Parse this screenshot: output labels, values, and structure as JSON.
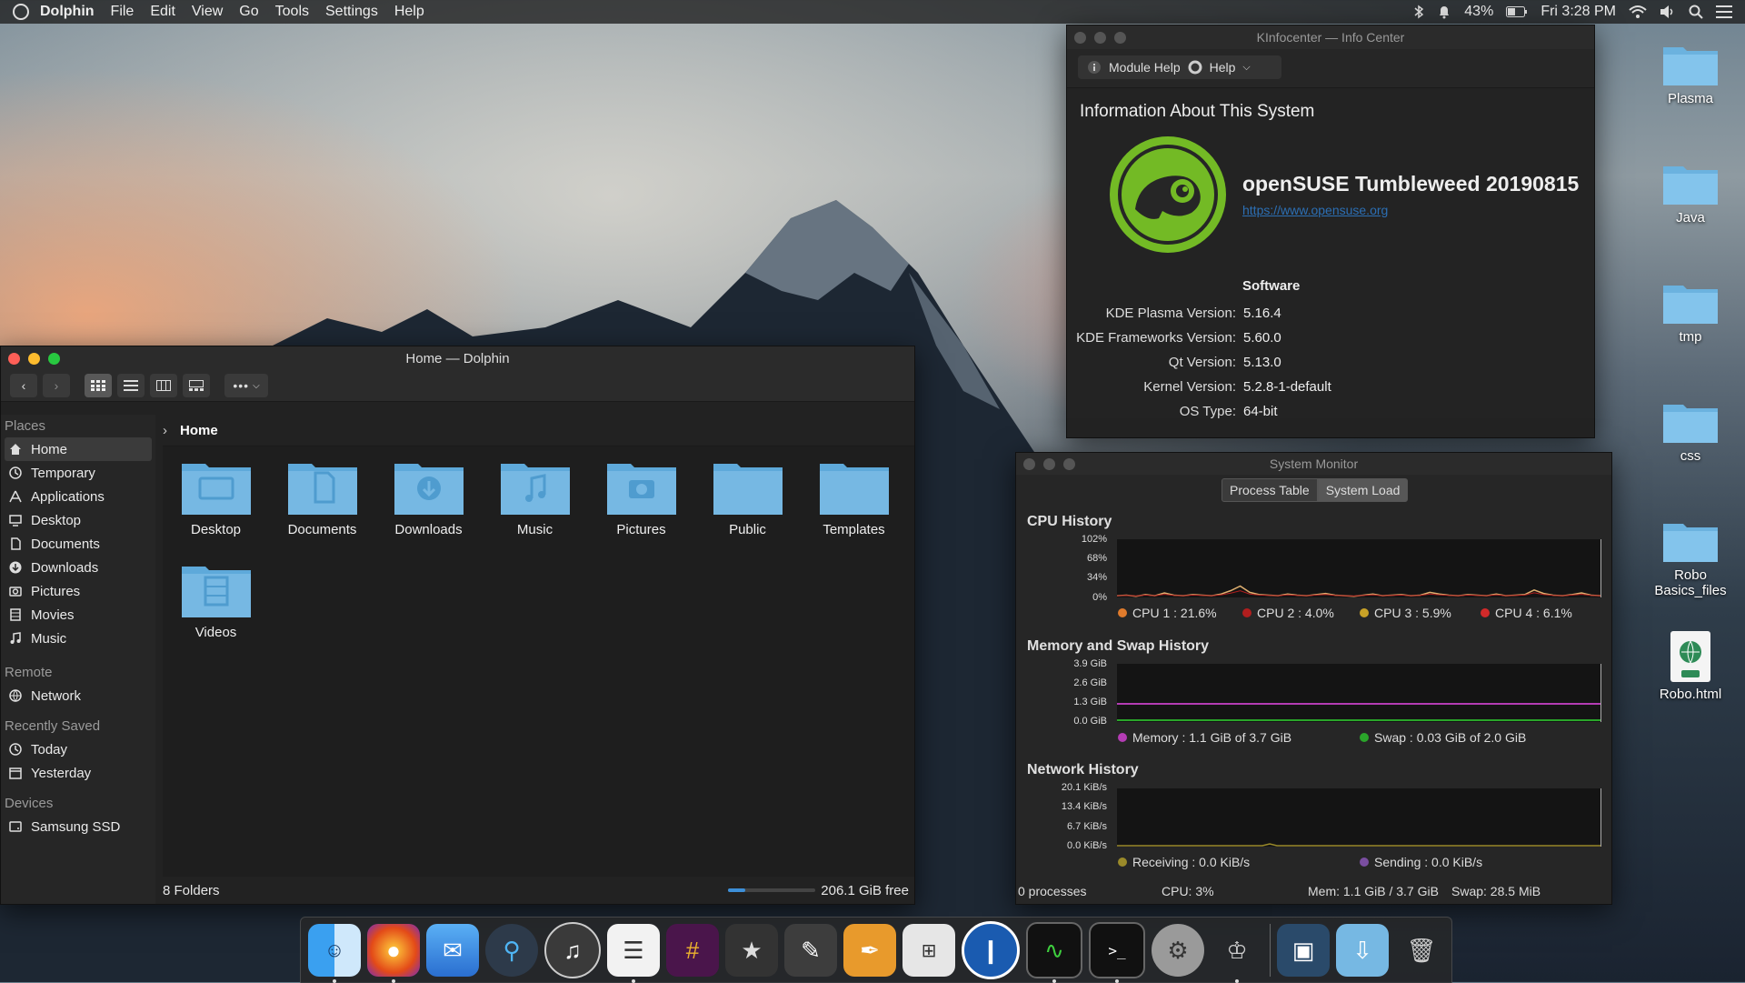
{
  "colors": {
    "accent": "#3d8fd8",
    "folder": "#76b8e3",
    "suse_green": "#73ba25",
    "close": "#ff5f57",
    "minimize": "#febc2e",
    "maximize": "#28c840"
  },
  "menubar": {
    "app": "Dolphin",
    "items": [
      "File",
      "Edit",
      "View",
      "Go",
      "Tools",
      "Settings",
      "Help"
    ],
    "battery": "43%",
    "clock": "Fri 3:28 PM"
  },
  "dolphin": {
    "title": "Home — Dolphin",
    "breadcrumb": "Home",
    "sidebar": {
      "places_label": "Places",
      "places": [
        {
          "label": "Home",
          "icon": "home-icon"
        },
        {
          "label": "Temporary",
          "icon": "clock-icon"
        },
        {
          "label": "Applications",
          "icon": "apps-icon"
        },
        {
          "label": "Desktop",
          "icon": "desktop-icon"
        },
        {
          "label": "Documents",
          "icon": "document-icon"
        },
        {
          "label": "Downloads",
          "icon": "download-icon"
        },
        {
          "label": "Pictures",
          "icon": "camera-icon"
        },
        {
          "label": "Movies",
          "icon": "film-icon"
        },
        {
          "label": "Music",
          "icon": "music-icon"
        }
      ],
      "remote_label": "Remote",
      "remote": [
        {
          "label": "Network",
          "icon": "globe-icon"
        }
      ],
      "recent_label": "Recently Saved",
      "recent": [
        {
          "label": "Today",
          "icon": "clock-icon"
        },
        {
          "label": "Yesterday",
          "icon": "calendar-icon"
        }
      ],
      "devices_label": "Devices",
      "devices": [
        {
          "label": "Samsung SSD",
          "icon": "drive-icon"
        }
      ]
    },
    "folders": [
      {
        "label": "Desktop",
        "icon": "desktop"
      },
      {
        "label": "Documents",
        "icon": "document"
      },
      {
        "label": "Downloads",
        "icon": "download"
      },
      {
        "label": "Music",
        "icon": "music"
      },
      {
        "label": "Pictures",
        "icon": "camera"
      },
      {
        "label": "Public",
        "icon": "none"
      },
      {
        "label": "Templates",
        "icon": "none"
      },
      {
        "label": "Videos",
        "icon": "film"
      }
    ],
    "status_count": "8 Folders",
    "status_free": "206.1 GiB free",
    "disk_used_fraction": 0.2
  },
  "kinfo": {
    "title": "KInfocenter — Info Center",
    "module_help": "Module Help",
    "help": "Help",
    "heading": "Information About This System",
    "os": "openSUSE Tumbleweed 20190815",
    "link": "https://www.opensuse.org",
    "software_label": "Software",
    "rows": [
      {
        "label": "KDE Plasma Version:",
        "value": "5.16.4"
      },
      {
        "label": "KDE Frameworks Version:",
        "value": "5.60.0"
      },
      {
        "label": "Qt Version:",
        "value": "5.13.0"
      },
      {
        "label": "Kernel Version:",
        "value": "5.2.8-1-default"
      },
      {
        "label": "OS Type:",
        "value": "64-bit"
      }
    ]
  },
  "sysmon": {
    "title": "System Monitor",
    "tabs": [
      "Process Table",
      "System Load"
    ],
    "cpu": {
      "title": "CPU History",
      "yticks": [
        "102%",
        "68%",
        "34%",
        "0%"
      ],
      "legend": [
        {
          "label": "CPU 1 : 21.6%",
          "color": "#e07b2c"
        },
        {
          "label": "CPU 2 : 4.0%",
          "color": "#b11e1e"
        },
        {
          "label": "CPU 3 : 5.9%",
          "color": "#c9a227"
        },
        {
          "label": "CPU 4 : 6.1%",
          "color": "#d22a2a"
        }
      ],
      "series": [
        3,
        4,
        2,
        5,
        3,
        8,
        4,
        3,
        5,
        4,
        3,
        6,
        12,
        20,
        9,
        5,
        4,
        3,
        6,
        4,
        3,
        5,
        7,
        4,
        3,
        2,
        4,
        6,
        3,
        4,
        5,
        3,
        4,
        9,
        6,
        4,
        3,
        5,
        4,
        3,
        6,
        3,
        4,
        5,
        13,
        7,
        4,
        3,
        5,
        8,
        4,
        3
      ]
    },
    "mem": {
      "title": "Memory and Swap History",
      "yticks": [
        "3.9 GiB",
        "2.6 GiB",
        "1.3 GiB",
        "0.0 GiB"
      ],
      "legend": [
        {
          "label": "Memory : 1.1 GiB of 3.7 GiB",
          "color": "#b43cb4"
        },
        {
          "label": "Swap : 0.03 GiB of 2.0 GiB",
          "color": "#2aa52a"
        }
      ]
    },
    "net": {
      "title": "Network History",
      "yticks": [
        "20.1 KiB/s",
        "13.4 KiB/s",
        "6.7 KiB/s",
        "0.0 KiB/s"
      ],
      "legend": [
        {
          "label": "Receiving : 0.0 KiB/s",
          "color": "#9a8a2a"
        },
        {
          "label": "Sending : 0.0 KiB/s",
          "color": "#7a4ea0"
        }
      ]
    },
    "status": {
      "processes": "0 processes",
      "cpu": "CPU: 3%",
      "mem": "Mem: 1.1 GiB / 3.7 GiB",
      "swap": "Swap: 28.5 MiB"
    }
  },
  "desktop_icons": [
    {
      "label": "Plasma",
      "type": "folder"
    },
    {
      "label": "Java",
      "type": "folder"
    },
    {
      "label": "tmp",
      "type": "folder"
    },
    {
      "label": "css",
      "type": "folder"
    },
    {
      "label": "Robo Basics_files",
      "type": "folder"
    },
    {
      "label": "Robo.html",
      "type": "html"
    }
  ],
  "dock": [
    {
      "name": "finder",
      "icon": "finder-icon",
      "running": true
    },
    {
      "name": "firefox",
      "icon": "firefox-icon",
      "running": true
    },
    {
      "name": "mail",
      "icon": "mail-icon",
      "running": false
    },
    {
      "name": "quicktime",
      "icon": "quicktime-icon",
      "running": false
    },
    {
      "name": "itunes",
      "icon": "music-icon",
      "running": false
    },
    {
      "name": "reminders",
      "icon": "list-icon",
      "running": true
    },
    {
      "name": "slack",
      "icon": "slack-icon",
      "running": false
    },
    {
      "name": "imovie",
      "icon": "star-icon",
      "running": false
    },
    {
      "name": "textedit",
      "icon": "notepad-icon",
      "running": false
    },
    {
      "name": "pages",
      "icon": "pen-icon",
      "running": false
    },
    {
      "name": "calculator",
      "icon": "calculator-icon",
      "running": false
    },
    {
      "name": "1password",
      "icon": "lock-icon",
      "running": false
    },
    {
      "name": "activity-monitor",
      "icon": "activity-icon",
      "running": true
    },
    {
      "name": "terminal",
      "icon": "terminal-icon",
      "running": true
    },
    {
      "name": "settings",
      "icon": "gear-icon",
      "running": false
    },
    {
      "name": "automator",
      "icon": "robot-icon",
      "running": true
    },
    {
      "name": "preview",
      "icon": "photo-icon",
      "running": false
    },
    {
      "name": "downloads",
      "icon": "download-folder-icon",
      "running": false
    },
    {
      "name": "trash",
      "icon": "trash-icon",
      "running": false
    }
  ]
}
